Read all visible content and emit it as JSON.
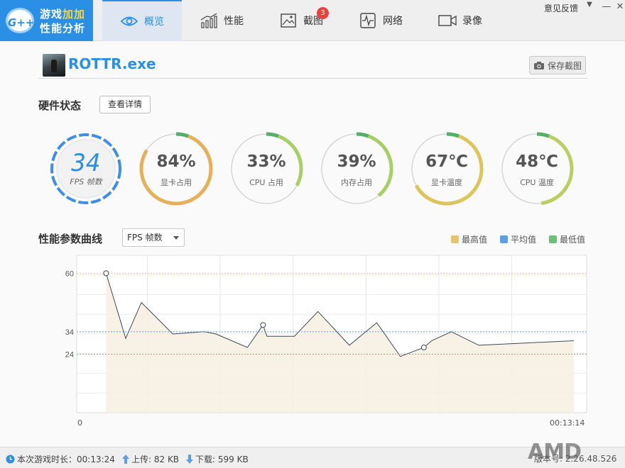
{
  "app": {
    "logo_badge": "G++",
    "logo_line1_a": "游戏",
    "logo_line1_b": "加加",
    "logo_line2": "性能分析"
  },
  "tabs": [
    {
      "label": "概览",
      "icon": "eye-icon",
      "active": true
    },
    {
      "label": "性能",
      "icon": "bar-chart-icon",
      "active": false
    },
    {
      "label": "截图",
      "icon": "picture-icon",
      "active": false,
      "badge": "3"
    },
    {
      "label": "网络",
      "icon": "pulse-icon",
      "active": false
    },
    {
      "label": "录像",
      "icon": "video-camera-icon",
      "active": false
    }
  ],
  "window": {
    "feedback": "意见反馈",
    "minimize": "—",
    "close": "✕"
  },
  "process": {
    "name": "ROTTR.exe",
    "save_label": "保存截图"
  },
  "hardware": {
    "title": "硬件状态",
    "detail_label": "查看详情",
    "fps": {
      "value": "34",
      "label": "FPS 帧数"
    },
    "gauges": [
      {
        "value": "84%",
        "label": "显卡占用",
        "fraction": 0.84
      },
      {
        "value": "33%",
        "label": "CPU 占用",
        "fraction": 0.33
      },
      {
        "value": "39%",
        "label": "内存占用",
        "fraction": 0.39
      },
      {
        "value": "67℃",
        "label": "显卡温度",
        "fraction": 0.67
      },
      {
        "value": "48℃",
        "label": "CPU 温度",
        "fraction": 0.48
      }
    ]
  },
  "curve": {
    "title": "性能参数曲线",
    "selected": "FPS 帧数",
    "legend": [
      {
        "label": "最高值",
        "color": "#e9c46a"
      },
      {
        "label": "平均值",
        "color": "#5b9fe8"
      },
      {
        "label": "最低值",
        "color": "#6cbf73"
      }
    ],
    "time_start": "0",
    "time_end": "00:13:14"
  },
  "chart_data": {
    "type": "area",
    "y_ticks": [
      60,
      34,
      24
    ],
    "max": 60,
    "avg": 34,
    "min": 24,
    "ylim": [
      -2,
      68
    ],
    "xlim": [
      -15,
      245
    ],
    "x": [
      0,
      10,
      18,
      34,
      50,
      56,
      72,
      80,
      82,
      96,
      108,
      124,
      138,
      150,
      162,
      166,
      176,
      190
    ],
    "y": [
      60,
      31,
      47,
      33,
      34,
      33,
      27,
      37,
      32,
      32,
      43,
      28,
      38,
      23,
      27,
      30,
      34,
      28
    ],
    "fps_end": 30,
    "markers": [
      0,
      80,
      162
    ]
  },
  "status": {
    "playtime": "本次游戏时长：00:13:24",
    "upload": "上传: 82 KB",
    "download": "下载: 599 KB",
    "amd_logo": "AMD",
    "version": "版本号: 2.26.48.526"
  }
}
